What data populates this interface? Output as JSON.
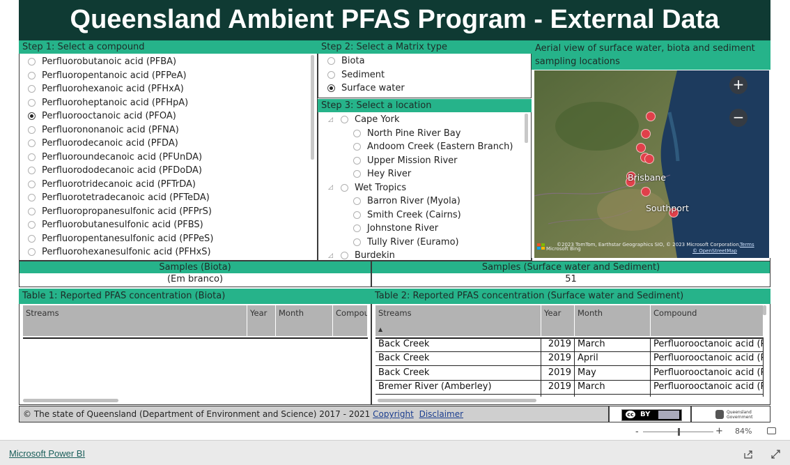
{
  "title": "Queensland Ambient PFAS Program - External Data",
  "step1": {
    "header": "Step 1: Select a compound",
    "items": [
      {
        "label": "Perfluorobutanoic acid (PFBA)",
        "selected": false
      },
      {
        "label": "Perfluoropentanoic acid (PFPeA)",
        "selected": false
      },
      {
        "label": "Perfluorohexanoic acid (PFHxA)",
        "selected": false
      },
      {
        "label": "Perfluoroheptanoic acid (PFHpA)",
        "selected": false
      },
      {
        "label": "Perfluorooctanoic acid (PFOA)",
        "selected": true
      },
      {
        "label": "Perfluorononanoic acid (PFNA)",
        "selected": false
      },
      {
        "label": "Perfluorodecanoic acid (PFDA)",
        "selected": false
      },
      {
        "label": "Perfluoroundecanoic acid (PFUnDA)",
        "selected": false
      },
      {
        "label": "Perfluorododecanoic acid (PFDoDA)",
        "selected": false
      },
      {
        "label": "Perfluorotridecanoic acid (PFTrDA)",
        "selected": false
      },
      {
        "label": "Perfluorotetradecanoic acid (PFTeDA)",
        "selected": false
      },
      {
        "label": "Perfluoropropanesulfonic acid (PFPrS)",
        "selected": false
      },
      {
        "label": "Perfluorobutanesulfonic acid (PFBS)",
        "selected": false
      },
      {
        "label": "Perfluoropentanesulfonic acid (PFPeS)",
        "selected": false
      },
      {
        "label": "Perfluorohexanesulfonic acid (PFHxS)",
        "selected": false
      }
    ]
  },
  "step2": {
    "header": "Step 2: Select a Matrix type",
    "items": [
      {
        "label": "Biota",
        "selected": false
      },
      {
        "label": "Sediment",
        "selected": false
      },
      {
        "label": "Surface water",
        "selected": true
      }
    ]
  },
  "step3": {
    "header": "Step 3: Select a location",
    "items": [
      {
        "label": "Cape York",
        "level": 0
      },
      {
        "label": "North Pine River Bay",
        "level": 1
      },
      {
        "label": "Andoom Creek (Eastern Branch)",
        "level": 1
      },
      {
        "label": "Upper Mission River",
        "level": 1
      },
      {
        "label": "Hey River",
        "level": 1
      },
      {
        "label": "Wet Tropics",
        "level": 0
      },
      {
        "label": "Barron River (Myola)",
        "level": 1
      },
      {
        "label": "Smith Creek (Cairns)",
        "level": 1
      },
      {
        "label": "Johnstone River",
        "level": 1
      },
      {
        "label": "Tully River (Euramo)",
        "level": 1
      },
      {
        "label": "Burdekin",
        "level": 0
      }
    ]
  },
  "map": {
    "header": "Aerial view of surface water, biota and sediment sampling locations",
    "zoom_in": "+",
    "zoom_out": "−",
    "label_brisbane": "Brisbane",
    "label_southport": "Southport",
    "attribution": "©2023 TomTom, Earthstar Geographics SIO, © 2023 Microsoft Corporation,",
    "terms": "Terms",
    "osm": "© OpenStreetMap",
    "bing": "Microsoft Bing"
  },
  "cards": {
    "biota_title": "Samples (Biota)",
    "biota_value": "(Em branco)",
    "water_title": "Samples (Surface water and Sediment)",
    "water_value": "51"
  },
  "table1": {
    "header": "Table 1: Reported PFAS concentration (Biota)",
    "columns": [
      "Streams",
      "Year",
      "Month",
      "Compou"
    ]
  },
  "table2": {
    "header": "Table 2: Reported PFAS concentration (Surface water and Sediment)",
    "columns": [
      "Streams",
      "Year",
      "Month",
      "Compound"
    ],
    "sort_arrow": "▲",
    "rows": [
      {
        "stream": "Back Creek",
        "year": "2019",
        "month": "March",
        "compound": "Perfluorooctanoic acid (PF"
      },
      {
        "stream": "Back Creek",
        "year": "2019",
        "month": "April",
        "compound": "Perfluorooctanoic acid (PF"
      },
      {
        "stream": "Back Creek",
        "year": "2019",
        "month": "May",
        "compound": "Perfluorooctanoic acid (PF"
      },
      {
        "stream": "Bremer River (Amberley)",
        "year": "2019",
        "month": "March",
        "compound": "Perfluorooctanoic acid (PF"
      },
      {
        "stream": "Bremer River (Amberley)",
        "year": "2019",
        "month": "April",
        "compound": "Perfluorooctanoic acid (PF"
      }
    ]
  },
  "footer": {
    "text": "© The state of Queensland (Department of Environment and Science) 2017 - 2021",
    "copyright": "Copyright",
    "disclaimer": "Disclaimer",
    "cc_label": "cc",
    "by_label": "BY",
    "qld_logo": "Queensland Government"
  },
  "bottom": {
    "powerbi_link": "Microsoft Power BI",
    "zoom_minus": "-",
    "zoom_plus": "+",
    "zoom_level": "84%",
    "zoom_fraction": 0.5
  }
}
